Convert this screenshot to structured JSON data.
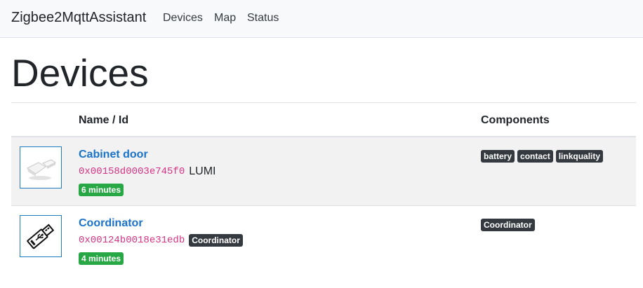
{
  "navbar": {
    "brand": "Zigbee2MqttAssistant",
    "links": [
      "Devices",
      "Map",
      "Status"
    ]
  },
  "page": {
    "title": "Devices"
  },
  "table": {
    "headers": {
      "image": "",
      "name_id": "Name / Id",
      "components": "Components"
    },
    "rows": [
      {
        "name": "Cabinet door",
        "id": "0x00158d0003e745f0",
        "vendor": "LUMI",
        "type_badge": "",
        "last_seen": "6 minutes",
        "components": [
          "battery",
          "contact",
          "linkquality"
        ],
        "image_icon": "door-sensor-icon"
      },
      {
        "name": "Coordinator",
        "id": "0x00124b0018e31edb",
        "vendor": "",
        "type_badge": "Coordinator",
        "last_seen": "4 minutes",
        "components": [
          "Coordinator"
        ],
        "image_icon": "usb-stick-icon"
      }
    ]
  },
  "colors": {
    "link": "#1a73c9",
    "success_badge": "#28a745",
    "dark_badge": "#343a40",
    "code": "#d63384"
  }
}
